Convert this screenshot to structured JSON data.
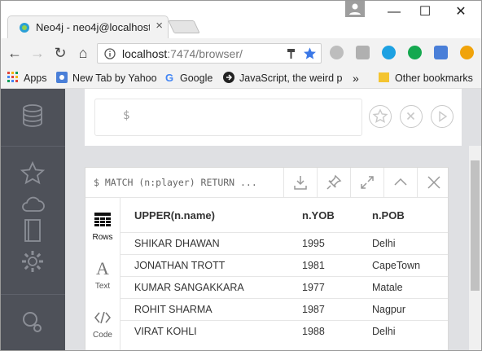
{
  "browser": {
    "tab_title": "Neo4j - neo4j@localhost",
    "tab_close": "×",
    "url_host": "localhost",
    "url_rest": ":7474/browser/",
    "window_min": "—",
    "window_max": "☐",
    "window_close": "✕"
  },
  "bookmarks": {
    "apps": "Apps",
    "items": [
      "New Tab by Yahoo",
      "Google",
      "JavaScript, the weird p"
    ],
    "more": "»",
    "other": "Other bookmarks"
  },
  "editor": {
    "prompt": "$"
  },
  "frame": {
    "query": "$ MATCH (n:player) RETURN ...",
    "view_tabs": [
      "Rows",
      "Text",
      "Code"
    ],
    "columns": [
      "UPPER(n.name)",
      "n.YOB",
      "n.POB"
    ],
    "rows": [
      [
        "SHIKAR DHAWAN",
        "1995",
        "Delhi"
      ],
      [
        "JONATHAN TROTT",
        "1981",
        "CapeTown"
      ],
      [
        "KUMAR SANGAKKARA",
        "1977",
        "Matale"
      ],
      [
        "ROHIT SHARMA",
        "1987",
        "Nagpur"
      ],
      [
        "VIRAT KOHLI",
        "1988",
        "Delhi"
      ]
    ]
  },
  "colors": {
    "sidebar": "#4e5159",
    "accent_star": "#3b78e7"
  }
}
